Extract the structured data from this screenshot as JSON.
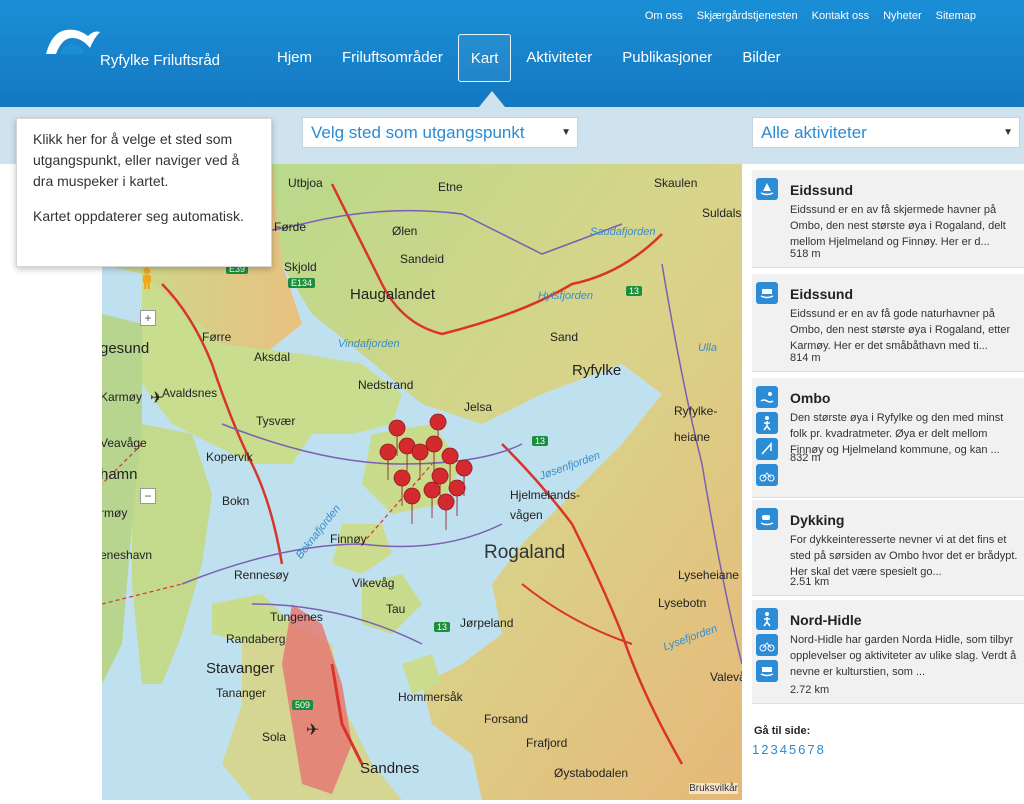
{
  "brand": {
    "name": "Ryfylke Friluftsråd"
  },
  "top_links": [
    "Om oss",
    "Skjærgårdstjenesten",
    "Kontakt oss",
    "Nyheter",
    "Sitemap"
  ],
  "nav": [
    "Hjem",
    "Friluftsområder",
    "Kart",
    "Aktiviteter",
    "Publikasjoner",
    "Bilder"
  ],
  "nav_active": "Kart",
  "filters": {
    "place_select": "Velg sted som utgangspunkt",
    "activity_select": "Alle aktiviteter"
  },
  "tooltip": {
    "line1": "Klikk her for å velge et sted som utgangspunkt, eller naviger ved å dra muspeker i kartet.",
    "line2": "Kartet oppdaterer seg automatisk."
  },
  "map": {
    "labels": [
      "Utbjoa",
      "Etne",
      "Skaulen",
      "Suldalsh",
      "Ølen",
      "Sandeid",
      "Saudafjorden",
      "Skjold",
      "Haugalandet",
      "Hylsfjorden",
      "Førde",
      "Førre",
      "Aksdal",
      "Sand",
      "Ryfylke",
      "Vindafjorden",
      "Nedstrand",
      "Avaldsnes",
      "Tysvær",
      "Jelsa",
      "Ryfylke-",
      "heiane",
      "Kopervik",
      "Bokn",
      "Hjelmelands-",
      "vågen",
      "Rogaland",
      "Finnøy",
      "Boknafjorden",
      "Rennesøy",
      "Vikevåg",
      "Lyseheiane",
      "Tungenes",
      "Tau",
      "Jørpeland",
      "Lysebotn",
      "Randaberg",
      "Stavanger",
      "Tananger",
      "Lysefjorden",
      "Hommersåk",
      "Forsand",
      "Frafjord",
      "Sola",
      "Sandnes",
      "Øystabodalen",
      "Valevå",
      "Karmøy",
      "Veavåge",
      "hamn",
      "rmøy",
      "eneshavn",
      "gesund",
      "Ulla",
      "Jøsenfjorden"
    ],
    "roads": [
      "E39",
      "E134",
      "13",
      "13",
      "13",
      "509"
    ],
    "credit": "Bruksvilkår",
    "zoom_in": "+",
    "zoom_out": "−"
  },
  "results": [
    {
      "title": "Eidssund",
      "desc": "Eidssund er en av få skjermede havner på Ombo, den nest største øya i Rogaland, delt mellom Hjelmeland og Finnøy. Her er d...",
      "distance": "518 m",
      "icons": [
        "harbor-icon"
      ]
    },
    {
      "title": "Eidssund",
      "desc": "Eidssund er en av få gode naturhavner på Ombo, den nest største øya i Rogaland, etter Karmøy. Her er det småbåthavn med ti...",
      "distance": "814 m",
      "icons": [
        "ferry-icon"
      ]
    },
    {
      "title": "Ombo",
      "desc": "Den største øya i Ryfylke og den med minst folk pr. kvadratmeter. Øya er delt mellom Finnøy og Hjelmeland kommune, og kan ...",
      "distance": "832 m",
      "icons": [
        "swim-icon",
        "hiking-icon",
        "fishing-icon",
        "cycling-icon"
      ]
    },
    {
      "title": "Dykking",
      "desc": "For dykkeinteresserte nevner vi at det fins et sted på sørsiden av Ombo hvor det er brådypt. Her skal det være spesielt go...",
      "distance": "2.51 km",
      "icons": [
        "diving-icon"
      ]
    },
    {
      "title": "Nord-Hidle",
      "desc": "Nord-Hidle har garden Norda Hidle, som tilbyr opplevelser og aktiviteter av ulike slag. Verdt å nevne er kulturstien, som ...",
      "distance": "2.72 km",
      "icons": [
        "hiking-icon",
        "cycling-icon",
        "ferry-icon"
      ]
    }
  ],
  "pager": {
    "label": "Gå til side:",
    "pages": [
      "1",
      "2",
      "3",
      "4",
      "5",
      "6",
      "7",
      "8"
    ]
  }
}
